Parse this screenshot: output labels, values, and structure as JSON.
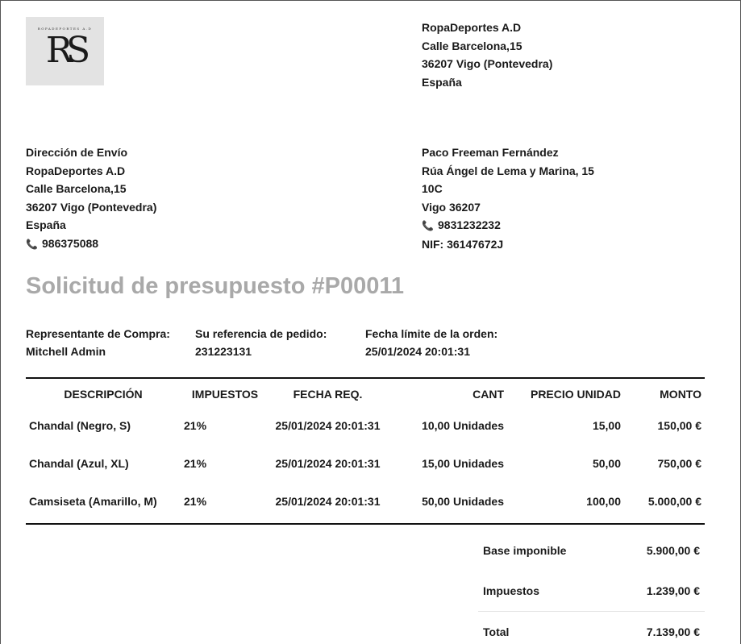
{
  "logo": {
    "small_text": "ROPADEPORTES A.D",
    "monogram": "RS"
  },
  "company": {
    "name": "RopaDeportes A.D",
    "street": "Calle Barcelona,15",
    "city": "36207 Vigo (Pontevedra)",
    "country": "España"
  },
  "shipping": {
    "heading": "Dirección de Envío",
    "name": "RopaDeportes A.D",
    "street": "Calle Barcelona,15",
    "city": "36207 Vigo (Pontevedra)",
    "country": "España",
    "phone": "986375088"
  },
  "client": {
    "name": "Paco Freeman Fernández",
    "street": "Rúa Ángel de Lema y Marina, 15",
    "street2": "10C",
    "city": "Vigo 36207",
    "phone": "9831232232",
    "nif": "NIF: 36147672J"
  },
  "title": "Solicitud de presupuesto #P00011",
  "info": {
    "rep_label": "Representante de Compra:",
    "rep_value": "Mitchell Admin",
    "ref_label": "Su referencia de pedido:",
    "ref_value": "231223131",
    "deadline_label": "Fecha límite de la orden:",
    "deadline_value": "25/01/2024 20:01:31"
  },
  "table": {
    "headers": {
      "description": "DESCRIPCIÓN",
      "taxes": "IMPUESTOS",
      "date": "FECHA REQ.",
      "qty": "CANT",
      "price": "PRECIO UNIDAD",
      "amount": "MONTO"
    },
    "rows": [
      {
        "description": "Chandal (Negro, S)",
        "taxes": "21%",
        "date": "25/01/2024 20:01:31",
        "qty": "10,00 Unidades",
        "price": "15,00",
        "amount": "150,00 €"
      },
      {
        "description": "Chandal (Azul, XL)",
        "taxes": "21%",
        "date": "25/01/2024 20:01:31",
        "qty": "15,00 Unidades",
        "price": "50,00",
        "amount": "750,00 €"
      },
      {
        "description": "Camsiseta (Amarillo, M)",
        "taxes": "21%",
        "date": "25/01/2024 20:01:31",
        "qty": "50,00 Unidades",
        "price": "100,00",
        "amount": "5.000,00 €"
      }
    ]
  },
  "totals": {
    "base_label": "Base imponible",
    "base_value": "5.900,00 €",
    "tax_label": "Impuestos",
    "tax_value": "1.239,00 €",
    "total_label": "Total",
    "total_value": "7.139,00 €"
  },
  "colors": {
    "title": "#a9a9a9",
    "logo_bg": "#e3e3e3",
    "rule": "#111111"
  },
  "icons": {
    "phone": "phone-icon"
  }
}
